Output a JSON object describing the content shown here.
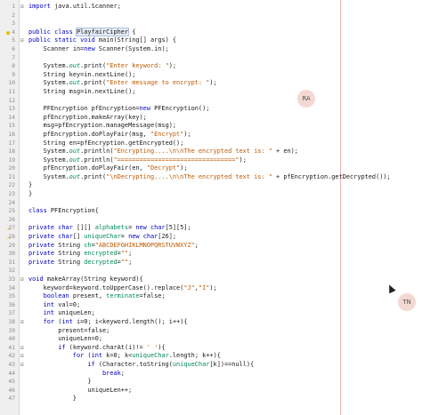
{
  "editor": {
    "lines": [
      {
        "n": "1",
        "m": "minus",
        "t": "import java.util.Scanner;"
      },
      {
        "n": "2",
        "m": "",
        "t": ""
      },
      {
        "n": "3",
        "m": "",
        "t": ""
      },
      {
        "n": "4",
        "m": "bulb",
        "t": "public class PlayfairCipher {"
      },
      {
        "n": "5",
        "m": "minus",
        "t": "public static void main(String[] args) {"
      },
      {
        "n": "6",
        "m": "",
        "t": "    Scanner in=new Scanner(System.in);"
      },
      {
        "n": "7",
        "m": "",
        "t": ""
      },
      {
        "n": "8",
        "m": "",
        "t": "    System.out.print(\"Enter keyword: \");"
      },
      {
        "n": "9",
        "m": "",
        "t": "    String key=in.nextLine();"
      },
      {
        "n": "10",
        "m": "",
        "t": "    System.out.print(\"Enter message to encrypt: \");"
      },
      {
        "n": "11",
        "m": "",
        "t": "    String msg=in.nextLine();"
      },
      {
        "n": "12",
        "m": "",
        "t": ""
      },
      {
        "n": "13",
        "m": "",
        "t": "    PFEncryption pfEncryption=new PFEncryption();"
      },
      {
        "n": "14",
        "m": "",
        "t": "    pfEncryption.makeArray(key);"
      },
      {
        "n": "15",
        "m": "",
        "t": "    msg=pfEncryption.manageMessage(msg);"
      },
      {
        "n": "16",
        "m": "",
        "t": "    pfEncryption.doPlayFair(msg, \"Encrypt\");"
      },
      {
        "n": "17",
        "m": "",
        "t": "    String en=pfEncryption.getEncrypted();"
      },
      {
        "n": "18",
        "m": "",
        "t": "    System.out.println(\"Encrypting....\\n\\nThe encrypted text is: \" + en);"
      },
      {
        "n": "19",
        "m": "",
        "t": "    System.out.println(\"================================\");"
      },
      {
        "n": "20",
        "m": "",
        "t": "    pfEncryption.doPlayFair(en, \"Decrypt\");"
      },
      {
        "n": "21",
        "m": "",
        "t": "    System.out.print(\"\\nDecrypting....\\n\\nThe encrypted text is: \" + pfEncryption.getDecrypted());"
      },
      {
        "n": "22",
        "m": "",
        "t": "}"
      },
      {
        "n": "23",
        "m": "",
        "t": "}"
      },
      {
        "n": "24",
        "m": "",
        "t": ""
      },
      {
        "n": "25",
        "m": "",
        "t": "class PFEncryption{"
      },
      {
        "n": "26",
        "m": "",
        "t": ""
      },
      {
        "n": "27",
        "m": "warn",
        "t": "private char [][] alphabets= new char[5][5];"
      },
      {
        "n": "28",
        "m": "warn",
        "t": "private char[] uniqueChar= new char[26];"
      },
      {
        "n": "29",
        "m": "",
        "t": "private String ch=\"ABCDEFGHIKLMNOPQRSTUVWXYZ\";"
      },
      {
        "n": "30",
        "m": "",
        "t": "private String encrypted=\"\";"
      },
      {
        "n": "31",
        "m": "",
        "t": "private String decrypted=\"\";"
      },
      {
        "n": "32",
        "m": "",
        "t": ""
      },
      {
        "n": "33",
        "m": "minus",
        "t": "void makeArray(String keyword){"
      },
      {
        "n": "34",
        "m": "",
        "t": "    keyword=keyword.toUpperCase().replace(\"J\",\"I\");"
      },
      {
        "n": "35",
        "m": "",
        "t": "    boolean present, terminate=false;"
      },
      {
        "n": "36",
        "m": "",
        "t": "    int val=0;"
      },
      {
        "n": "37",
        "m": "",
        "t": "    int uniqueLen;"
      },
      {
        "n": "38",
        "m": "minus",
        "t": "    for (int i=0; i<keyword.length(); i++){"
      },
      {
        "n": "39",
        "m": "",
        "t": "        present=false;"
      },
      {
        "n": "40",
        "m": "",
        "t": "        uniqueLen=0;"
      },
      {
        "n": "41",
        "m": "minus",
        "t": "        if (keyword.charAt(i)!= ' '){"
      },
      {
        "n": "42",
        "m": "minus",
        "t": "            for (int k=0; k<uniqueChar.length; k++){"
      },
      {
        "n": "43",
        "m": "minus",
        "t": "                if (Character.toString(uniqueChar[k])==null){"
      },
      {
        "n": "44",
        "m": "",
        "t": "                    break;"
      },
      {
        "n": "45",
        "m": "",
        "t": "                }"
      },
      {
        "n": "46",
        "m": "",
        "t": "                uniqueLen++;"
      },
      {
        "n": "47",
        "m": "",
        "t": "            }"
      }
    ],
    "keywords": [
      "import",
      "public",
      "class",
      "static",
      "void",
      "new",
      "private",
      "char",
      "boolean",
      "int",
      "for",
      "if",
      "break"
    ],
    "fields": [
      "alphabets",
      "uniqueChar",
      "ch",
      "encrypted",
      "decrypted",
      "terminate"
    ],
    "italics": [
      "out"
    ],
    "highlight": "PlayfairCipher",
    "colors": {
      "keyword": "#0000c8",
      "string": "#c05a00",
      "field": "#008a5a",
      "warning": "#e0a000",
      "bulb": "#e8c000"
    }
  },
  "collaborators": [
    {
      "initials": "RA"
    },
    {
      "initials": "TN"
    }
  ]
}
